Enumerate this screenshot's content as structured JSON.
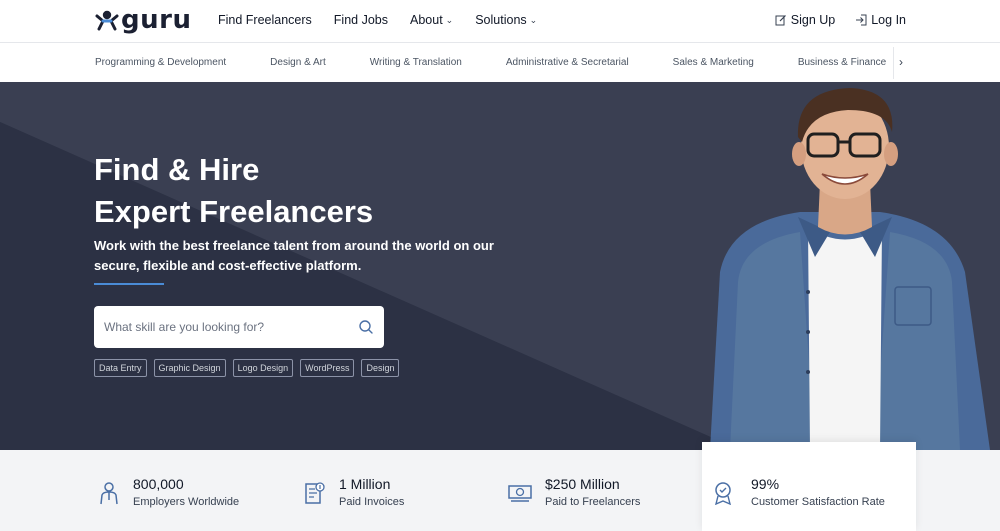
{
  "brand": {
    "name": "guru"
  },
  "nav": {
    "items": [
      {
        "label": "Find Freelancers",
        "dropdown": false
      },
      {
        "label": "Find Jobs",
        "dropdown": false
      },
      {
        "label": "About",
        "dropdown": true
      },
      {
        "label": "Solutions",
        "dropdown": true
      }
    ],
    "signup": "Sign Up",
    "login": "Log In"
  },
  "categories": [
    "Programming & Development",
    "Design & Art",
    "Writing & Translation",
    "Administrative & Secretarial",
    "Sales & Marketing",
    "Business & Finance"
  ],
  "hero": {
    "title_line1": "Find & Hire",
    "title_line2": "Expert Freelancers",
    "subtitle": "Work with the best freelance talent from around the world on our secure, flexible and cost-effective platform.",
    "search_placeholder": "What skill are you looking for?",
    "tags": [
      "Data Entry",
      "Graphic Design",
      "Logo Design",
      "WordPress",
      "Design"
    ]
  },
  "stats": [
    {
      "value": "800,000",
      "label": "Employers Worldwide",
      "icon": "employer-icon"
    },
    {
      "value": "1 Million",
      "label": "Paid Invoices",
      "icon": "invoice-icon"
    },
    {
      "value": "$250 Million",
      "label": "Paid to Freelancers",
      "icon": "money-icon"
    },
    {
      "value": "99%",
      "label": "Customer Satisfaction Rate",
      "icon": "award-icon"
    }
  ],
  "colors": {
    "hero_bg": "#2f3447",
    "accent": "#4a8bd6",
    "stats_bg": "#f3f4f6"
  }
}
